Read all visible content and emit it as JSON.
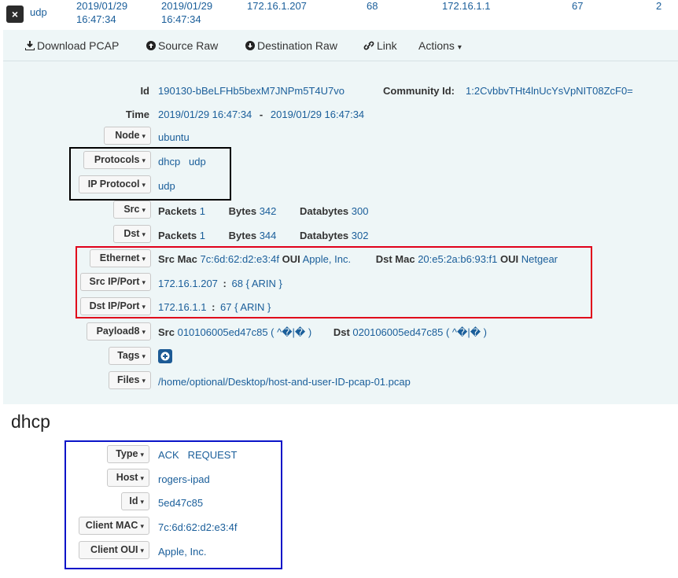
{
  "session": {
    "close_icon": "×",
    "protocol": "udp",
    "start_date": "2019/01/29",
    "start_time": "16:47:34",
    "stop_date": "2019/01/29",
    "stop_time": "16:47:34",
    "src_ip": "172.16.1.207",
    "src_port": "68",
    "dst_ip": "172.16.1.1",
    "dst_port": "67",
    "packets": "2"
  },
  "actions": {
    "download_pcap": "Download PCAP",
    "source_raw": "Source Raw",
    "destination_raw": "Destination Raw",
    "link": "Link",
    "actions": "Actions"
  },
  "fields": {
    "id_label": "Id",
    "id_value": "190130-bBeLFHb5bexM7JNPm5T4U7vo",
    "community_id_label": "Community Id:",
    "community_id_value": "1:2CvbbvTHt4lnUcYsVpNIT08ZcF0=",
    "time_label": "Time",
    "time_start": "2019/01/29 16:47:34",
    "time_dash": "-",
    "time_end": "2019/01/29 16:47:34",
    "node_label": "Node",
    "node_value": "ubuntu",
    "protocols_label": "Protocols",
    "protocols_values": [
      "dhcp",
      "udp"
    ],
    "ip_protocol_label": "IP Protocol",
    "ip_protocol_value": "udp",
    "src_label": "Src",
    "dst_label": "Dst",
    "packets_label": "Packets",
    "bytes_label": "Bytes",
    "databytes_label": "Databytes",
    "src_packets": "1",
    "src_bytes": "342",
    "src_databytes": "300",
    "dst_packets": "1",
    "dst_bytes": "344",
    "dst_databytes": "302",
    "ethernet_label": "Ethernet",
    "src_mac_label": "Src Mac",
    "src_mac": "7c:6d:62:d2:e3:4f",
    "oui_label": "OUI",
    "src_oui": "Apple, Inc.",
    "dst_mac_label": "Dst Mac",
    "dst_mac": "20:e5:2a:b6:93:f1",
    "dst_oui": "Netgear",
    "src_ip_port_label": "Src IP/Port",
    "src_ip": "172.16.1.207",
    "src_port": "68",
    "src_asn": "{ ARIN }",
    "dst_ip_port_label": "Dst IP/Port",
    "dst_ip": "172.16.1.1",
    "dst_port": "67",
    "dst_asn": "{ ARIN }",
    "colon": ":",
    "payload8_label": "Payload8",
    "payload_src_label": "Src",
    "payload_src_hex": "010106005ed47c85",
    "payload_src_ascii": "( ^�|� )",
    "payload_dst_label": "Dst",
    "payload_dst_hex": "020106005ed47c85",
    "payload_dst_ascii": "( ^�|� )",
    "tags_label": "Tags",
    "files_label": "Files",
    "files_value": "/home/optional/Desktop/host-and-user-ID-pcap-01.pcap"
  },
  "dhcp": {
    "title": "dhcp",
    "type_label": "Type",
    "type_values": [
      "ACK",
      "REQUEST"
    ],
    "host_label": "Host",
    "host_value": "rogers-ipad",
    "id_label": "Id",
    "id_value": "5ed47c85",
    "client_mac_label": "Client MAC",
    "client_mac_value": "7c:6d:62:d2:e3:4f",
    "client_oui_label": "Client OUI",
    "client_oui_value": "Apple, Inc."
  },
  "icons": {
    "caret": "▾",
    "download": "download-icon",
    "arrow_circle": "arrow-circle-icon",
    "link": "link-icon",
    "plus": "plus-icon"
  },
  "colors": {
    "link": "#1a5e9a",
    "panel_bg": "#eef6f7",
    "highlight_black": "#000000",
    "highlight_red": "#e0001a",
    "highlight_blue": "#0a14c8",
    "tag_button": "#1c5a95"
  }
}
